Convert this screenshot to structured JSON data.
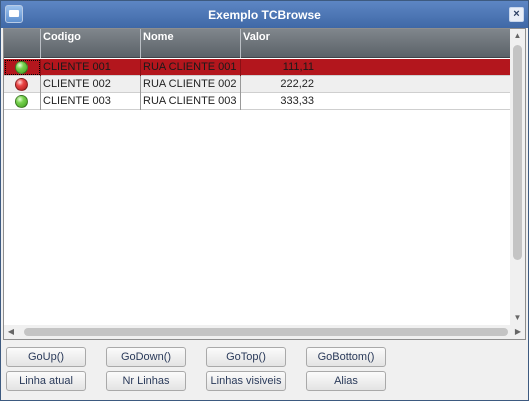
{
  "window": {
    "title": "Exemplo TCBrowse",
    "close_glyph": "×",
    "icon": "app-window-icon"
  },
  "grid": {
    "columns": [
      "",
      "Codigo",
      "Nome",
      "Valor"
    ],
    "rows": [
      {
        "status": "green",
        "codigo": "CLIENTE 001",
        "nome": "RUA CLIENTE 001",
        "valor": "111,11"
      },
      {
        "status": "red",
        "codigo": "CLIENTE 002",
        "nome": "RUA CLIENTE 002",
        "valor": "222,22"
      },
      {
        "status": "green",
        "codigo": "CLIENTE 003",
        "nome": "RUA CLIENTE 003",
        "valor": "333,33"
      }
    ],
    "selected_row": 0,
    "colors": {
      "header": "#5b6268",
      "selected": "#b3161d",
      "green": "#3f9e1e",
      "red": "#a81414"
    }
  },
  "scroll": {
    "up_glyph": "▲",
    "down_glyph": "▼",
    "left_glyph": "◀",
    "right_glyph": "▶"
  },
  "buttons": {
    "go_up": "GoUp()",
    "go_down": "GoDown()",
    "go_top": "GoTop()",
    "go_bottom": "GoBottom()",
    "linha_atual": "Linha atual",
    "nr_linhas": "Nr Linhas",
    "linhas_visiveis": "Linhas visiveis",
    "alias": "Alias"
  }
}
